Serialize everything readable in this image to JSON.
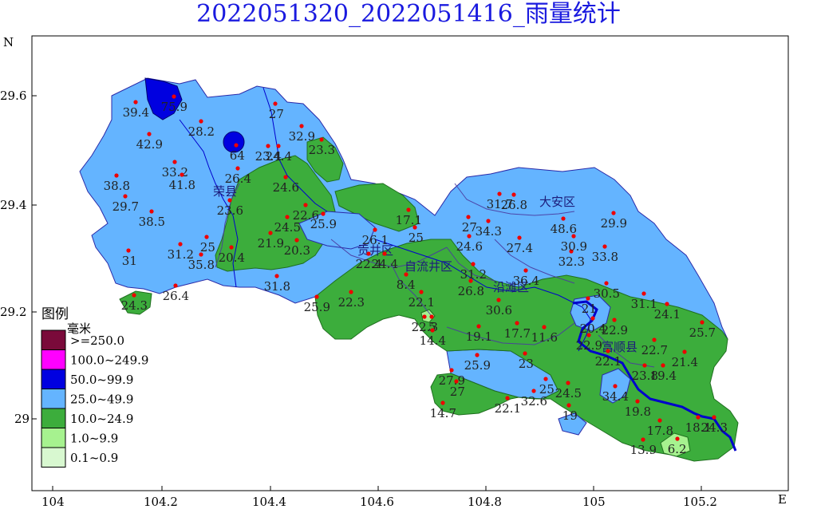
{
  "title": "2022051320_2022051416_雨量统计",
  "axes": {
    "north_label": "N",
    "east_label": "E",
    "y_ticks": [
      "29.6",
      "29.4",
      "29.2",
      "29"
    ],
    "x_ticks": [
      "104",
      "104.2",
      "104.4",
      "104.6",
      "104.8",
      "105",
      "105.2"
    ]
  },
  "legend": {
    "title": "图例",
    "unit": "毫米",
    "items": [
      {
        "label": ">=250.0",
        "color": "#7a0a3a"
      },
      {
        "label": "100.0~249.9",
        "color": "#ff00ff"
      },
      {
        "label": "50.0~99.9",
        "color": "#0000e0"
      },
      {
        "label": "25.0~49.9",
        "color": "#64b4ff"
      },
      {
        "label": "10.0~24.9",
        "color": "#3cad3c"
      },
      {
        "label": "1.0~9.9",
        "color": "#a6f28f"
      },
      {
        "label": "0.1~0.9",
        "color": "#d8f8d0"
      }
    ]
  },
  "districts": [
    "荣县",
    "贡井区",
    "自流井区",
    "大安区",
    "沿滩区",
    "富顺县"
  ],
  "stations": [
    "39.4",
    "75.9",
    "28.2",
    "42.9",
    "33.2",
    "41.8",
    "38.8",
    "29.7",
    "38.5",
    "31",
    "31.2",
    "25",
    "35.8",
    "20.4",
    "24.3",
    "26.4",
    "64",
    "26.4",
    "23.6",
    "27",
    "32.9",
    "23.3",
    "23.4",
    "24.4",
    "24.6",
    "22.6",
    "25.9",
    "24.5",
    "21.9",
    "20.3",
    "31.8",
    "25.9",
    "22.3",
    "26.1",
    "24.4",
    "22.4",
    "17.1",
    "25",
    "8.4",
    "22.1",
    "22.3",
    "5",
    "14.4",
    "27.9",
    "27",
    "14.7",
    "25.9",
    "22.1",
    "32.6",
    "25",
    "19",
    "24.5",
    "34.4",
    "19.8",
    "17.8",
    "13.9",
    "6.2",
    "18.1",
    "24.3",
    "19.4",
    "21.4",
    "22.7",
    "23.8",
    "22.1",
    "21",
    "22.9",
    "20.4",
    "22.9",
    "19.1",
    "17.7",
    "11.6",
    "23",
    "27",
    "31.7",
    "26.8",
    "34.3",
    "27.4",
    "31.2",
    "26.8",
    "24.6",
    "30.6",
    "36.4",
    "32.3",
    "30.9",
    "48.6",
    "33.8",
    "29.9",
    "30.5",
    "31.1",
    "24.1",
    "25.7"
  ],
  "colors": {
    "title": "#1a1adf",
    "heavy": "#0000e0",
    "moderate": "#64b4ff",
    "light": "#3cad3c",
    "verylight": "#a6f28f",
    "station": "#ee0000",
    "river": "#0000cc"
  }
}
